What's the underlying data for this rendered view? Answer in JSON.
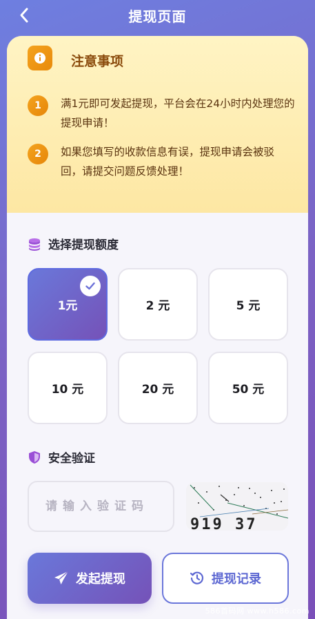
{
  "header": {
    "title": "提现页面",
    "back_icon": "chevron-left-icon"
  },
  "notice": {
    "icon": "info-icon",
    "title": "注意事项",
    "items": [
      {
        "num": "1",
        "text": "满1元即可发起提现，平台会在24小时内处理您的提现申请！"
      },
      {
        "num": "2",
        "text": "如果您填写的收款信息有误，提现申请会被驳回，请提交问题反馈处理！"
      }
    ]
  },
  "amount_section": {
    "icon": "coins-icon",
    "title": "选择提现额度",
    "options": [
      "1元",
      "2 元",
      "5 元",
      "10 元",
      "20 元",
      "50 元"
    ],
    "selected": "1元"
  },
  "verify_section": {
    "icon": "shield-icon",
    "title": "安全验证",
    "input_placeholder": "请输入验证码",
    "captcha_text": "919 37"
  },
  "actions": {
    "submit_label": "发起提现",
    "submit_icon": "paper-plane-icon",
    "record_label": "提现记录",
    "record_icon": "history-icon"
  },
  "watermark": "586首码网 www.h586.com",
  "colors": {
    "accent": "#6a78da",
    "accent_dark": "#7552b8",
    "notice_bg": "#fdeaa8",
    "notice_text": "#8a4a0b",
    "badge": "#f09a16"
  }
}
